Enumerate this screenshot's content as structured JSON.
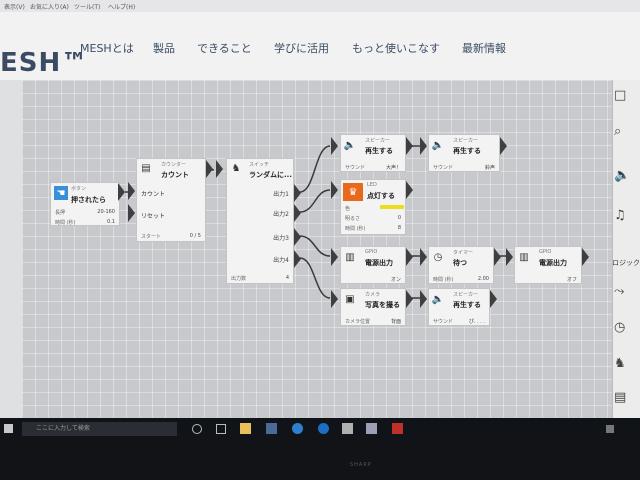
{
  "browser_menu": [
    "表示(V)",
    "お気に入り(A)",
    "ツール(T)",
    "ヘルプ(H)"
  ],
  "header": {
    "logo": "ESH™",
    "nav": [
      "MESHとは",
      "製品",
      "できること",
      "学びに活用",
      "もっと使いこなす",
      "最新情報"
    ]
  },
  "blocks": {
    "button": {
      "label": "ボタン",
      "action": "押されたら",
      "rows": [
        [
          "長押",
          "20-160"
        ],
        [
          "時間 (秒)",
          "0.1"
        ]
      ]
    },
    "counter": {
      "label": "カウンター",
      "action": "カウント",
      "ports": [
        "カウント",
        "リセット"
      ],
      "rows": [
        [
          "スタート",
          "0 / 5"
        ]
      ]
    },
    "switch": {
      "label": "スイッチ",
      "action": "ランダムに...",
      "outputs": [
        "出力1",
        "出力2",
        "出力3",
        "出力4"
      ],
      "rows": [
        [
          "出力数",
          "4"
        ]
      ]
    },
    "speaker1": {
      "label": "スピーカー",
      "action": "再生する",
      "rows": [
        [
          "サウンド",
          "大声！"
        ]
      ]
    },
    "speaker2": {
      "label": "スピーカー",
      "action": "再生する",
      "rows": [
        [
          "サウンド",
          "鈴声"
        ]
      ]
    },
    "led": {
      "label": "LED",
      "action": "点灯する",
      "rows": [
        [
          "色",
          ""
        ],
        [
          "明るさ",
          "0"
        ],
        [
          "時間 (秒)",
          "8"
        ]
      ]
    },
    "gpio1": {
      "label": "GPIO",
      "action": "電源出力",
      "rows": [
        [
          "",
          "オン"
        ]
      ]
    },
    "timer": {
      "label": "タイマー",
      "action": "待つ",
      "rows": [
        [
          "時間 (秒)",
          "2.00"
        ]
      ]
    },
    "gpio2": {
      "label": "GPIO",
      "action": "電源出力",
      "rows": [
        [
          "",
          "オフ"
        ]
      ]
    },
    "camera": {
      "label": "カメラ",
      "action": "写真を撮る",
      "rows": [
        [
          "カメラ位置",
          "背面"
        ]
      ]
    },
    "speaker3": {
      "label": "スピーカー",
      "action": "再生する",
      "rows": [
        [
          "サウンド",
          "ぴ. . . ."
        ]
      ]
    }
  },
  "right_panel": {
    "label": "ロジック"
  },
  "taskbar": {
    "search_placeholder": "ここに入力して検索"
  },
  "monitor_brand": "SHARP",
  "colors": {
    "wire": "#3a3a3c",
    "button_icon": "#3b8fd9",
    "led_icon": "#e8681c",
    "led_color_swatch": "#e9df1f"
  }
}
